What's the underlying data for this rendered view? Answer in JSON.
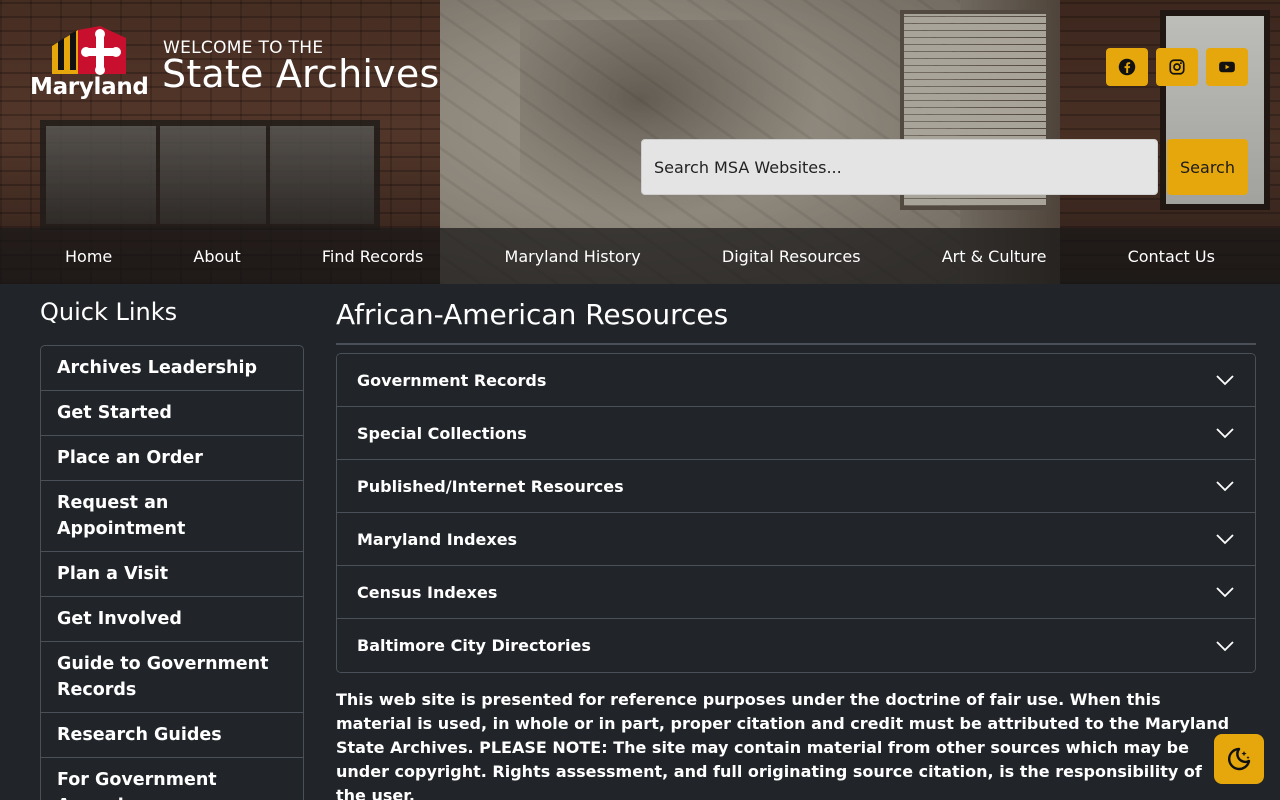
{
  "header": {
    "logo_text": "Maryland",
    "welcome": "WELCOME TO THE",
    "site_title": "State Archives",
    "social": [
      {
        "name": "facebook",
        "icon": "facebook-icon"
      },
      {
        "name": "instagram",
        "icon": "instagram-icon"
      },
      {
        "name": "youtube",
        "icon": "youtube-icon"
      }
    ],
    "search": {
      "placeholder": "Search MSA Websites...",
      "button": "Search"
    }
  },
  "nav": {
    "items": [
      "Home",
      "About",
      "Find Records",
      "Maryland History",
      "Digital Resources",
      "Art & Culture",
      "Contact Us"
    ]
  },
  "sidebar": {
    "title": "Quick Links",
    "items": [
      "Archives Leadership",
      "Get Started",
      "Place an Order",
      "Request an Appointment",
      "Plan a Visit",
      "Get Involved",
      "Guide to Government Records",
      "Research Guides",
      "For Government Agencies"
    ]
  },
  "main": {
    "title": "African-American Resources",
    "accordion": [
      "Government Records",
      "Special Collections",
      "Published/Internet Resources",
      "Maryland Indexes",
      "Census Indexes",
      "Baltimore City Directories"
    ],
    "notice": "This web site is presented for reference purposes under the doctrine of fair use. When this material is used, in whole or in part, proper citation and credit must be attributed to the Maryland State Archives. PLEASE NOTE: The site may contain material from other sources which may be under copyright. Rights assessment, and full originating source citation, is the responsibility of the user."
  },
  "theme": {
    "accent": "#e5a70b",
    "background": "#212529",
    "border": "#495057",
    "toggle_icon": "moon-stars-icon"
  }
}
